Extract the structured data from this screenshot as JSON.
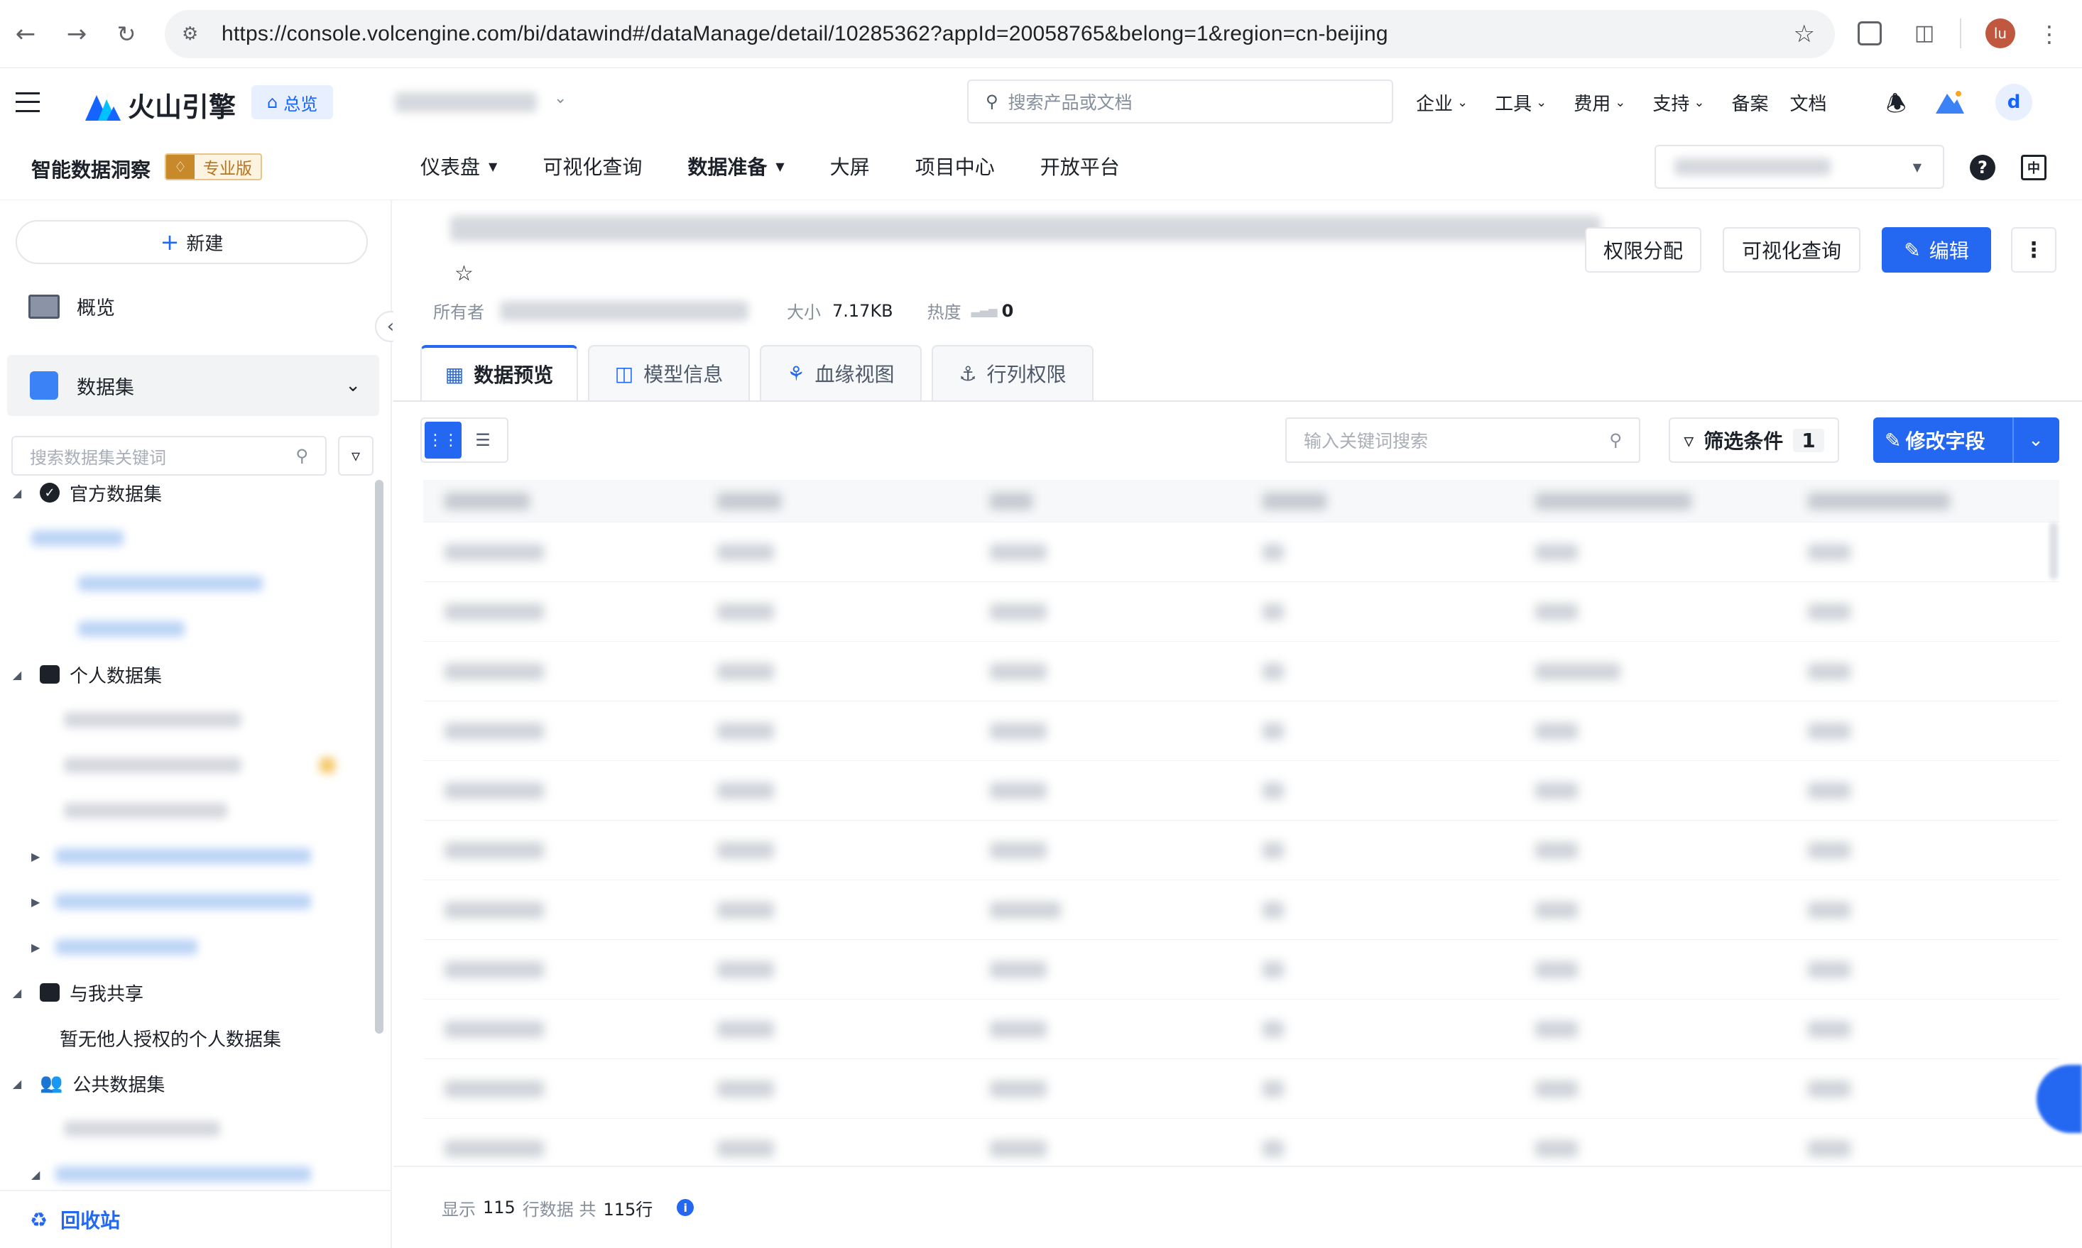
{
  "browser": {
    "url": "https://console.volcengine.com/bi/datawind#/dataManage/detail/10285362?appId=20058765&belong=1&region=cn-beijing",
    "profile_initials": "lu"
  },
  "header": {
    "brand": "火山引擎",
    "overview_tag": "总览",
    "search_placeholder": "搜索产品或文档",
    "menu": [
      "企业",
      "工具",
      "费用",
      "支持",
      "备案",
      "文档"
    ],
    "user_initial": "d"
  },
  "subnav": {
    "product": "智能数据洞察",
    "edition": "专业版",
    "items": [
      {
        "label": "仪表盘",
        "dropdown": true
      },
      {
        "label": "可视化查询",
        "dropdown": false
      },
      {
        "label": "数据准备",
        "dropdown": true
      },
      {
        "label": "大屏",
        "dropdown": false
      },
      {
        "label": "项目中心",
        "dropdown": false
      },
      {
        "label": "开放平台",
        "dropdown": false
      }
    ]
  },
  "sidebar": {
    "new_button": "新建",
    "overview": "概览",
    "datasets": "数据集",
    "search_placeholder": "搜索数据集关键词",
    "groups": {
      "official": "官方数据集",
      "personal": "个人数据集",
      "shared": "与我共享",
      "shared_empty": "暂无他人授权的个人数据集",
      "public": "公共数据集"
    },
    "recycle_bin": "回收站"
  },
  "detail": {
    "actions": {
      "permission": "权限分配",
      "visual_query": "可视化查询",
      "edit": "编辑"
    },
    "meta": {
      "owner_label": "所有者",
      "size_label": "大小",
      "size_value": "7.17KB",
      "heat_label": "热度",
      "heat_value": "0"
    },
    "tabs": [
      "数据预览",
      "模型信息",
      "血缘视图",
      "行列权限"
    ],
    "toolbar": {
      "search_placeholder": "输入关键词搜索",
      "filter_label": "筛选条件",
      "filter_count": "1",
      "modify_fields": "修改字段"
    },
    "footer": {
      "show_prefix": "显示",
      "rows_shown": "115",
      "rows_mid": "行数据 共",
      "rows_total": "115行"
    }
  },
  "colors": {
    "primary": "#2468f2",
    "text": "#1d2129",
    "muted": "#86909c",
    "badge_bg": "#fdf3e1",
    "badge_text": "#b8741a"
  }
}
